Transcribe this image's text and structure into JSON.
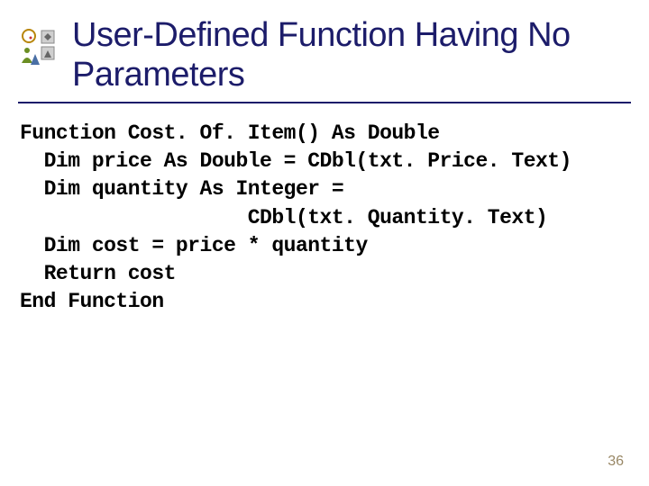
{
  "slide": {
    "title": "User-Defined Function Having No Parameters",
    "code_lines": [
      "Function Cost. Of. Item() As Double",
      "  Dim price As Double = CDbl(txt. Price. Text)",
      "  Dim quantity As Integer =",
      "                   CDbl(txt. Quantity. Text)",
      "  Dim cost = price * quantity",
      "  Return cost",
      "End Function"
    ],
    "page_number": "36"
  }
}
